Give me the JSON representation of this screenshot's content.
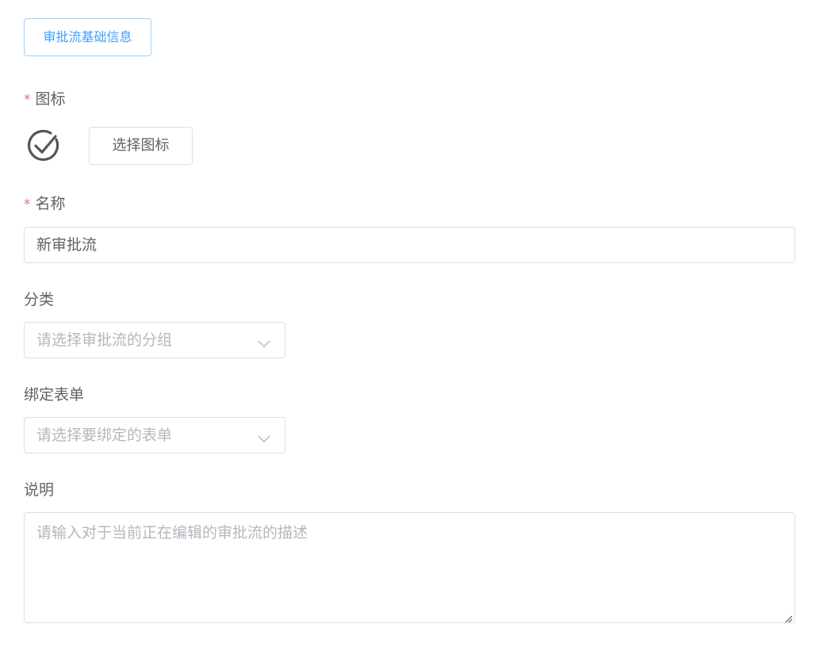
{
  "section": {
    "label": "审批流基础信息"
  },
  "icon_field": {
    "required_mark": "*",
    "label": "图标",
    "icon": "check-circle-icon",
    "button_label": "选择图标"
  },
  "name_field": {
    "required_mark": "*",
    "label": "名称",
    "value": "新审批流"
  },
  "category_field": {
    "label": "分类",
    "placeholder": "请选择审批流的分组",
    "icon": "chevron-down-icon"
  },
  "form_field": {
    "label": "绑定表单",
    "placeholder": "请选择要绑定的表单",
    "icon": "chevron-down-icon"
  },
  "description_field": {
    "label": "说明",
    "placeholder": "请输入对于当前正在编辑的审批流的描述"
  },
  "colors": {
    "primary": "#409eff",
    "required": "#f56c6c",
    "border": "#dcdfe6",
    "text": "#606266",
    "placeholder": "#b4b7be"
  }
}
